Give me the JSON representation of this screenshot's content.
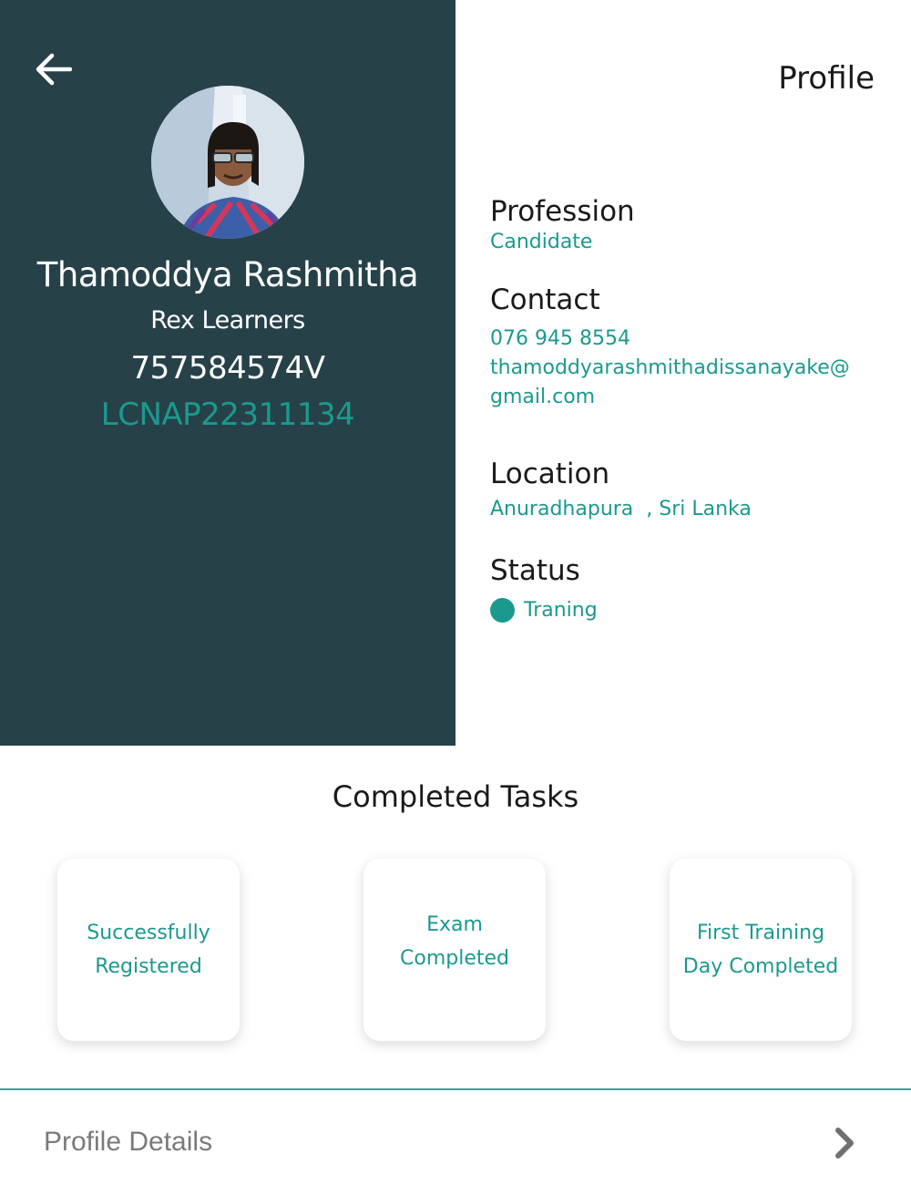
{
  "header": {
    "title": "Profile"
  },
  "user": {
    "name": "Thamoddya Rashmitha",
    "organization": "Rex Learners",
    "nic": "757584574V",
    "code": "LCNAP22311134"
  },
  "fields": {
    "profession": {
      "label": "Profession",
      "value": "Candidate"
    },
    "contact": {
      "label": "Contact",
      "phone": "076 945 8554",
      "email_line1": "thamoddyarashmithadissanayake@",
      "email_line2": "gmail.com"
    },
    "location": {
      "label": "Location",
      "value": "Anuradhapura  , Sri Lanka"
    },
    "status": {
      "label": "Status",
      "value": "Traning"
    }
  },
  "tasks": {
    "title": "Completed Tasks",
    "items": [
      {
        "line1": "Successfully",
        "line2": "Registered"
      },
      {
        "line1": "Exam",
        "line2": "Completed"
      },
      {
        "line1": "First Training",
        "line2": "Day Completed"
      }
    ]
  },
  "footer": {
    "details_label": "Profile Details"
  },
  "colors": {
    "panel": "#274149",
    "accent": "#1a9a8e",
    "divider": "#3aa39a"
  },
  "icons": {
    "back": "arrow-left-icon",
    "chevron": "chevron-right-icon",
    "status": "status-dot-icon"
  }
}
